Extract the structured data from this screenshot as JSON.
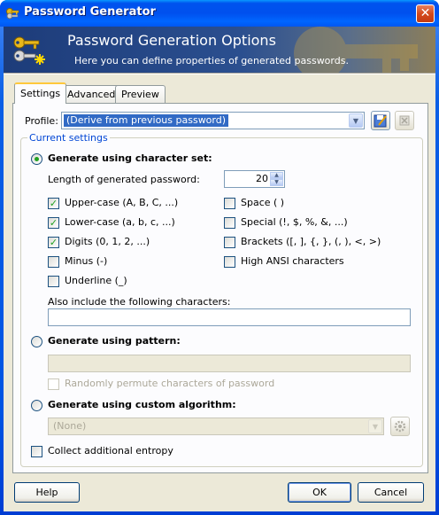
{
  "window": {
    "title": "Password Generator",
    "close_glyph": "✕"
  },
  "banner": {
    "title": "Password Generation Options",
    "subtitle": "Here you can define properties of generated passwords."
  },
  "tabs": [
    {
      "label": "Settings",
      "active": true
    },
    {
      "label": "Advanced",
      "active": false
    },
    {
      "label": "Preview",
      "active": false
    }
  ],
  "profile": {
    "label": "Profile:",
    "value": "(Derive from previous password)"
  },
  "current_settings": {
    "group_label": "Current settings",
    "charset": {
      "label": "Generate using character set:",
      "selected": true,
      "length_label": "Length of generated password:",
      "length_value": "20",
      "options": [
        {
          "label": "Upper-case (A, B, C, ...)",
          "checked": true
        },
        {
          "label": "Lower-case (a, b, c, ...)",
          "checked": true
        },
        {
          "label": "Digits (0, 1, 2, ...)",
          "checked": true
        },
        {
          "label": "Minus (-)",
          "checked": false
        },
        {
          "label": "Underline (_)",
          "checked": false
        },
        {
          "label": "Space ( )",
          "checked": false
        },
        {
          "label": "Special (!, $, %, &, ...)",
          "checked": false
        },
        {
          "label": "Brackets ([, ], {, }, (, ), <, >)",
          "checked": false
        },
        {
          "label": "High ANSI characters",
          "checked": false
        }
      ],
      "also_include_label": "Also include the following characters:",
      "also_include_value": ""
    },
    "pattern": {
      "label": "Generate using pattern:",
      "selected": false,
      "value": "",
      "permute_label": "Randomly permute characters of password",
      "permute_checked": false
    },
    "custom": {
      "label": "Generate using custom algorithm:",
      "selected": false,
      "value": "(None)"
    },
    "entropy": {
      "label": "Collect additional entropy",
      "checked": false
    }
  },
  "buttons": {
    "help": "Help",
    "ok": "OK",
    "cancel": "Cancel"
  },
  "colors": {
    "accent_blue": "#0054E3",
    "group_label": "#0046D5",
    "check_green": "#21A121",
    "selection": "#316AC5"
  }
}
